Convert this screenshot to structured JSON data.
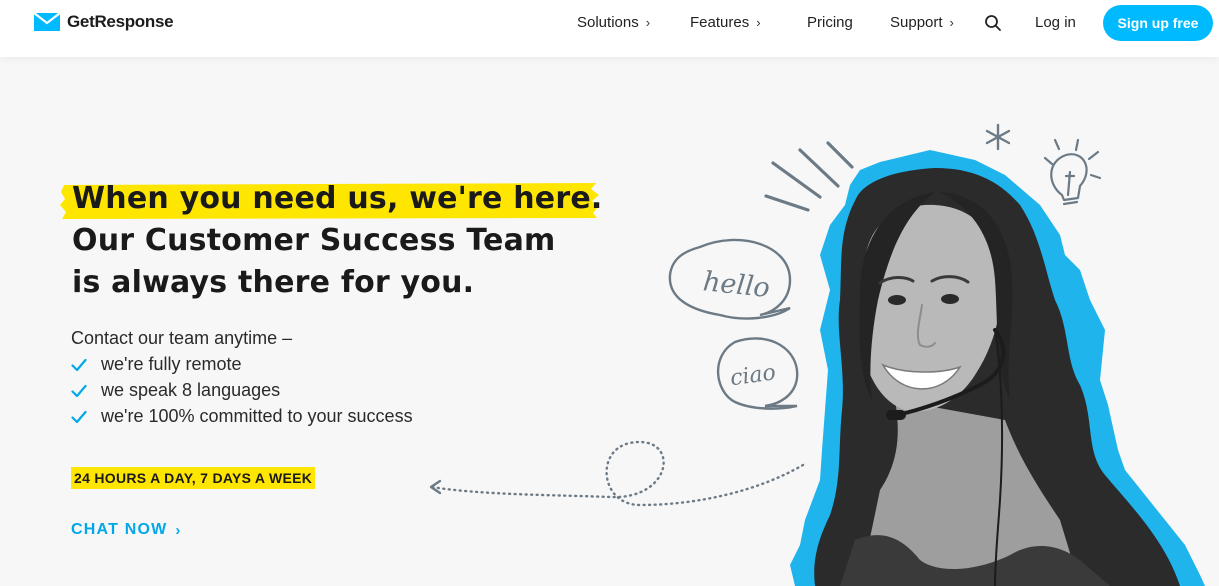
{
  "header": {
    "brand": "GetResponse",
    "nav": [
      {
        "label": "Solutions",
        "chevron": "›"
      },
      {
        "label": "Features",
        "chevron": "›"
      },
      {
        "label": "Pricing",
        "chevron": ""
      },
      {
        "label": "Support",
        "chevron": "›"
      }
    ],
    "login": "Log in",
    "signup": "Sign up free"
  },
  "hero": {
    "headline_highlight": "When you need us, we're here.",
    "headline_line2": "Our Customer Success Team",
    "headline_line3": "is always there for you.",
    "intro": "Contact our team anytime –",
    "points": [
      "we're fully remote",
      "we speak 8 languages",
      "we're 100% committed to your success"
    ],
    "hours_badge": "24 HOURS A DAY, 7 DAYS A WEEK",
    "cta": "CHAT NOW",
    "cta_chevron": "›",
    "bubble_hello": "hello",
    "bubble_ciao": "ciao"
  },
  "colors": {
    "accent_blue": "#00baff",
    "highlight_yellow": "#ffe600",
    "doodle_grey": "#6c7a86"
  },
  "icons": [
    "logo-envelope-icon",
    "search-icon",
    "check-icon",
    "asterisk-icon",
    "lightbulb-icon",
    "headset-icon"
  ]
}
